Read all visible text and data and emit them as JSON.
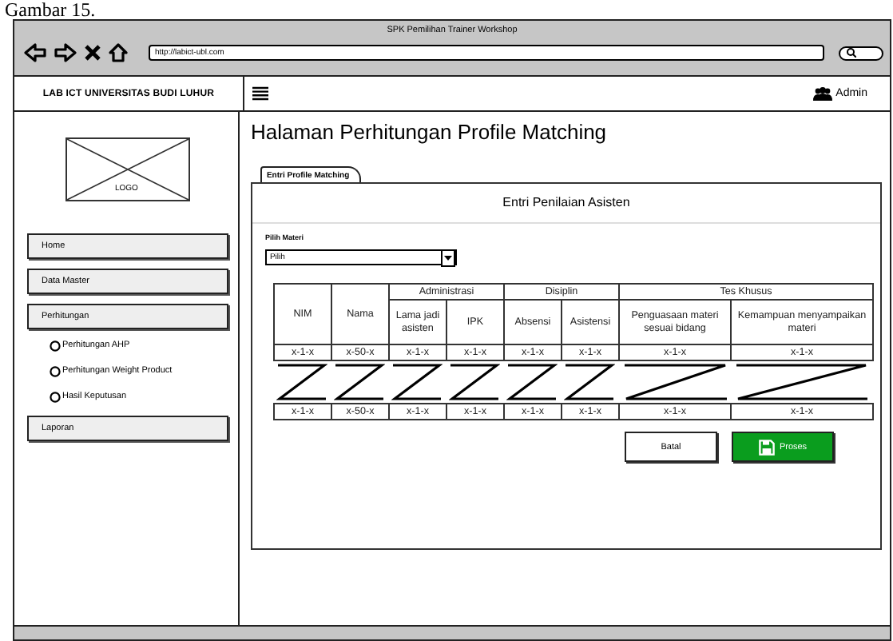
{
  "caption": "Gambar 15.",
  "window": {
    "title": "SPK Pemilihan Trainer Workshop",
    "url": "http://labict-ubl.com"
  },
  "header": {
    "brand": "LAB ICT UNIVERSITAS BUDI LUHUR",
    "user": "Admin"
  },
  "sidebar": {
    "logo": "LOGO",
    "items": [
      {
        "label": "Home",
        "kind": "button"
      },
      {
        "label": "Data Master",
        "kind": "button"
      },
      {
        "label": "Perhitungan",
        "kind": "button"
      },
      {
        "label": "Perhitungan AHP",
        "kind": "radio"
      },
      {
        "label": "Perhitungan Weight Product",
        "kind": "radio"
      },
      {
        "label": "Hasil Keputusan",
        "kind": "radio"
      },
      {
        "label": "Laporan",
        "kind": "button"
      }
    ]
  },
  "content": {
    "heading": "Halaman Perhitungan Profile Matching",
    "tabs": [
      {
        "label": "Entri Profile Matching",
        "selected": true
      }
    ],
    "panel_title": "Entri Penilaian Asisten",
    "field": {
      "label": "Pilih Materi",
      "value": "Pilih"
    },
    "table": {
      "header": [
        {
          "label": "NIM"
        },
        {
          "label": "Nama"
        },
        {
          "label": "Administrasi",
          "children": [
            {
              "label": "Lama jadi asisten"
            },
            {
              "label": "IPK"
            }
          ]
        },
        {
          "label": "Disiplin",
          "children": [
            {
              "label": "Absensi"
            },
            {
              "label": "Asistensi"
            }
          ]
        },
        {
          "label": "Tes Khusus",
          "children": [
            {
              "label": "Penguasaan materi sesuai bidang"
            },
            {
              "label": "Kemampuan menyampaikan materi"
            }
          ]
        }
      ],
      "rows": [
        {
          "kind": "data",
          "cells": [
            "x-1-x",
            "x-50-x",
            "x-1-x",
            "x-1-x",
            "x-1-x",
            "x-1-x",
            "x-1-x",
            "x-1-x"
          ]
        },
        {
          "kind": "gap"
        },
        {
          "kind": "data",
          "cells": [
            "x-1-x",
            "x-50-x",
            "x-1-x",
            "x-1-x",
            "x-1-x",
            "x-1-x",
            "x-1-x",
            "x-1-x"
          ]
        }
      ]
    },
    "buttons": [
      {
        "label": "Batal",
        "kind": "secondary"
      },
      {
        "label": "Proses",
        "kind": "primary"
      }
    ]
  }
}
